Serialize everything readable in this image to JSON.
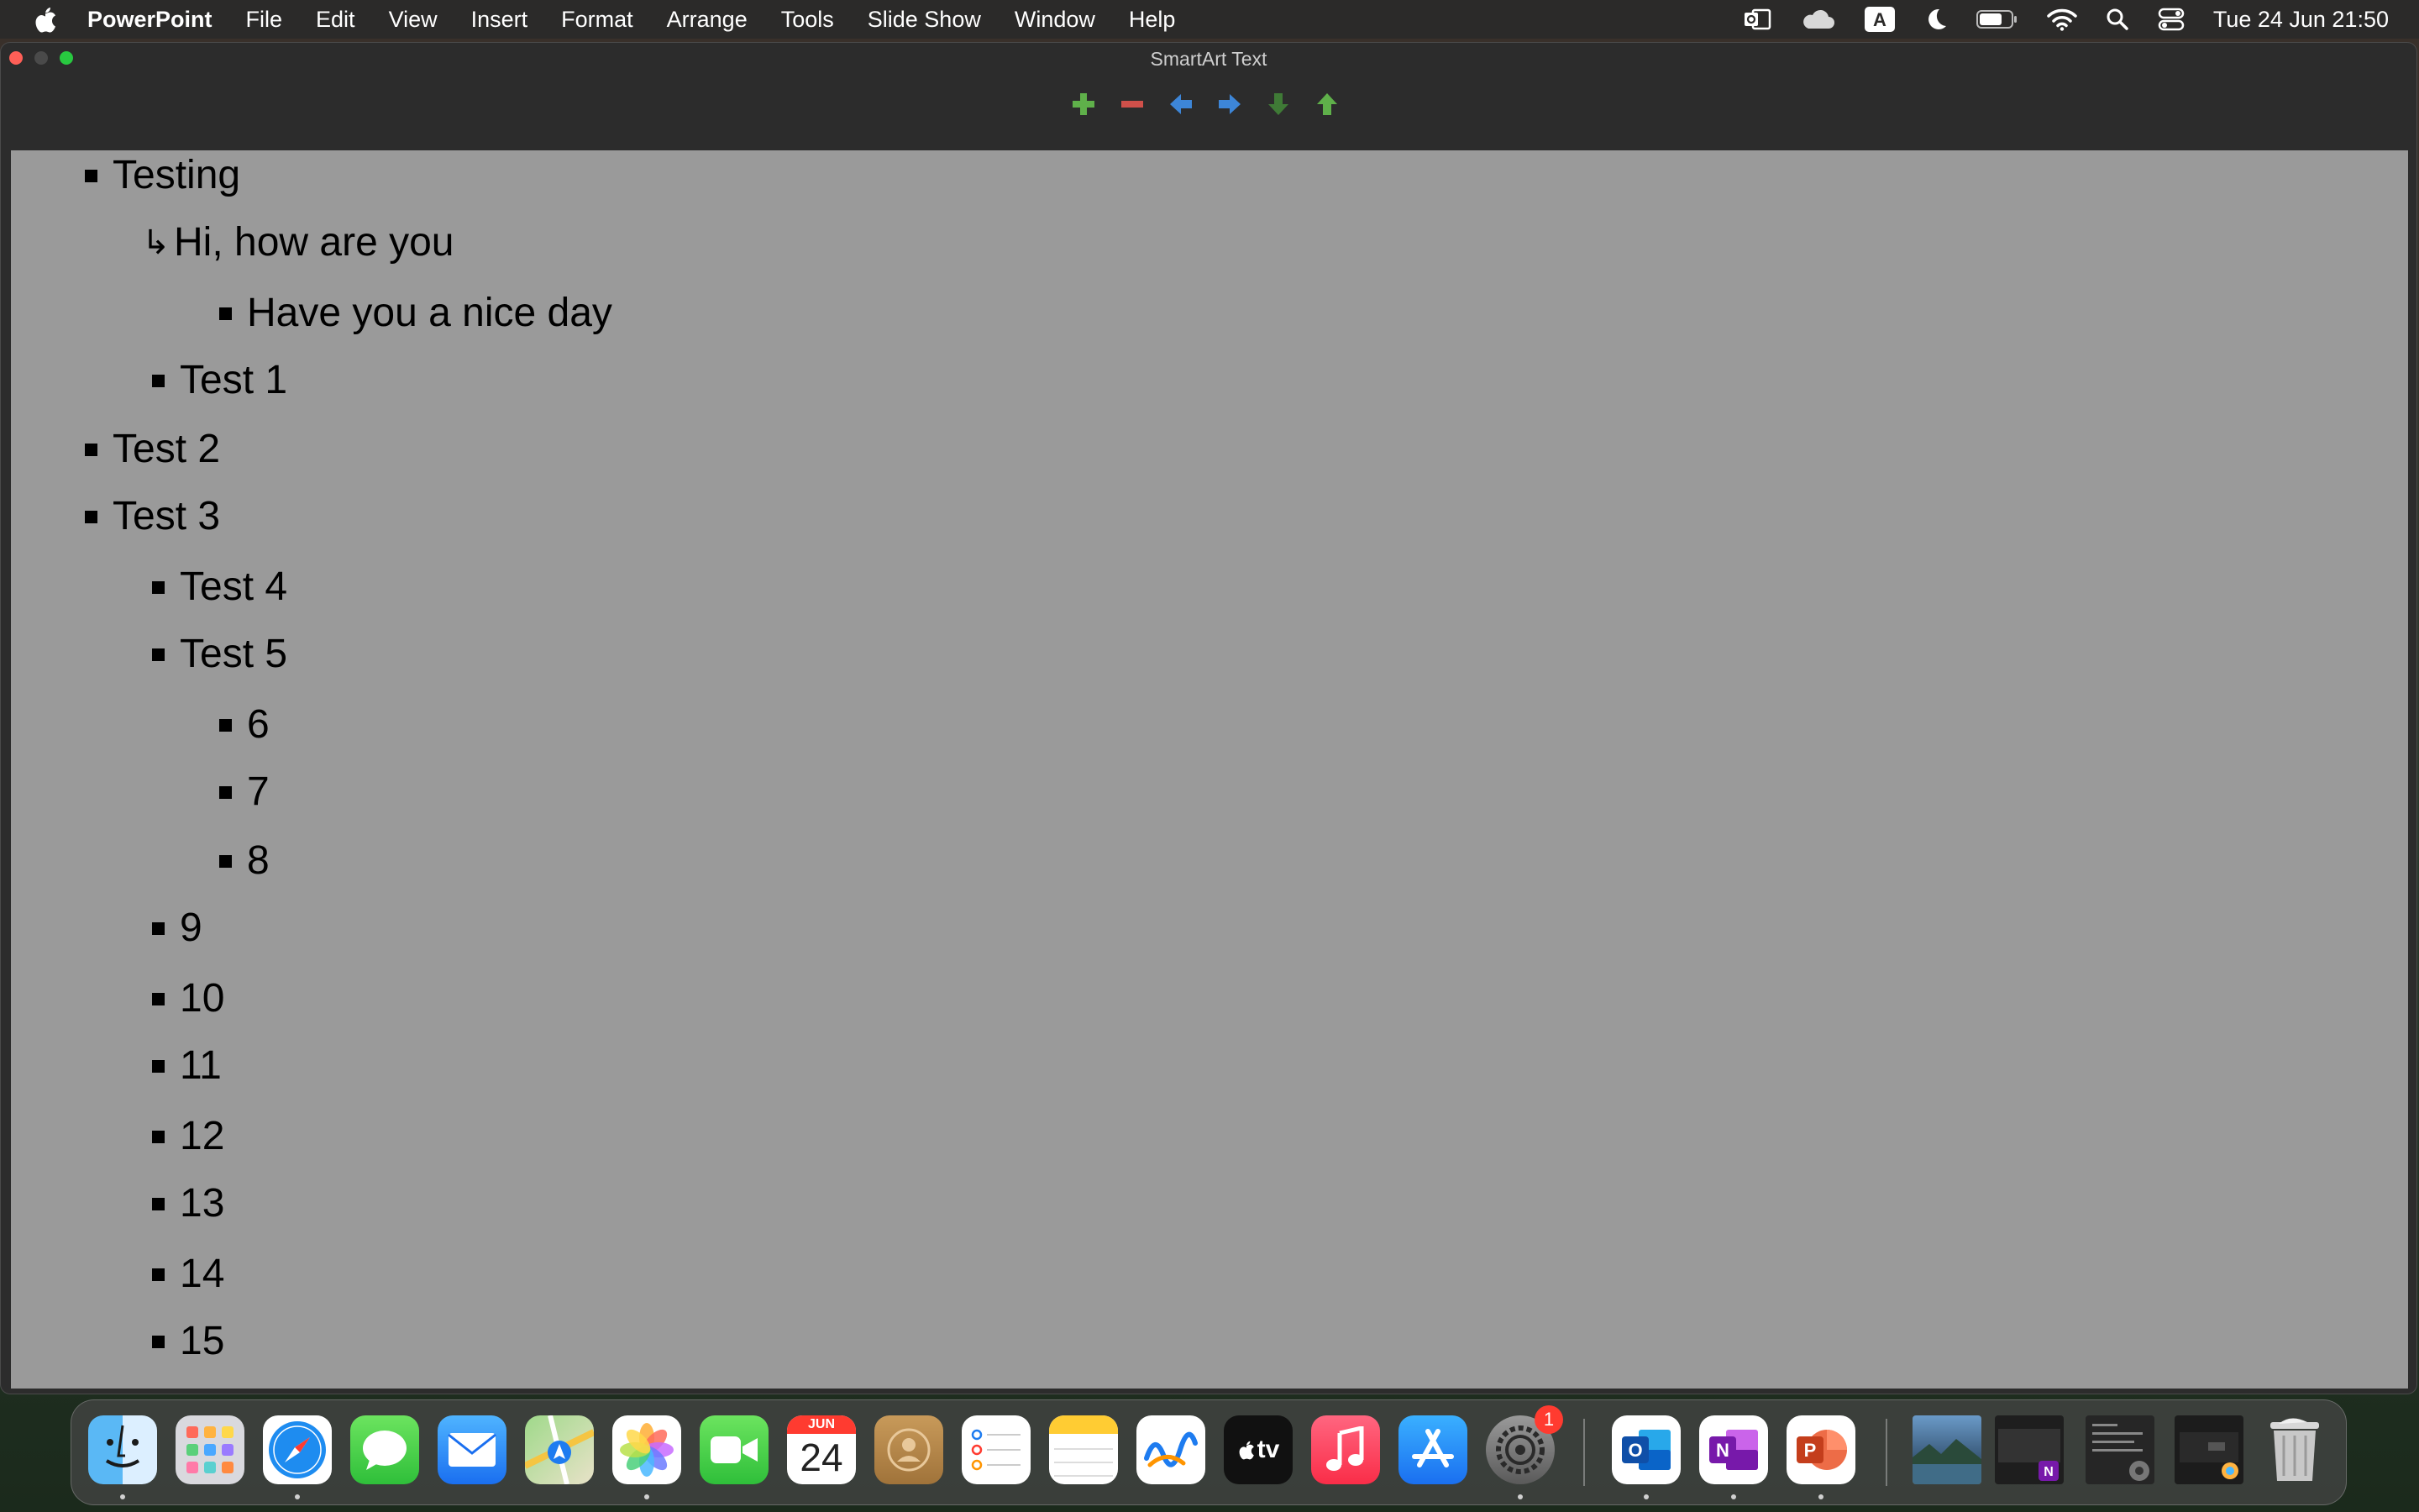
{
  "menubar": {
    "app_name": "PowerPoint",
    "menus": [
      "File",
      "Edit",
      "View",
      "Insert",
      "Format",
      "Arrange",
      "Tools",
      "Slide Show",
      "Window",
      "Help"
    ],
    "status_icons": [
      "outlook-status-icon",
      "onedrive-cloud-icon",
      "input-source-icon",
      "focus-moon-icon",
      "battery-icon",
      "wifi-icon",
      "spotlight-search-icon",
      "control-center-icon"
    ],
    "input_source_label": "A",
    "clock": "Tue 24 Jun  21:50"
  },
  "window": {
    "title": "SmartArt Text",
    "tools": [
      "add-bullet-icon",
      "remove-bullet-icon",
      "promote-left-icon",
      "demote-right-icon",
      "move-down-icon",
      "move-up-icon"
    ],
    "colors": {
      "add": "#5fb04a",
      "remove": "#d0504a",
      "arrow_blue": "#3d86d8",
      "down": "#3f7a36",
      "up": "#5fb04a",
      "content_bg": "#9a9a9a"
    }
  },
  "outline": [
    {
      "text": "Testing",
      "level": 0,
      "marker": "bullet"
    },
    {
      "text": "Hi, how are you",
      "level": 1,
      "marker": "arrow"
    },
    {
      "text": "Have you a nice day",
      "level": 2,
      "marker": "bullet"
    },
    {
      "text": "Test 1",
      "level": 1,
      "marker": "bullet"
    },
    {
      "text": "Test 2",
      "level": 0,
      "marker": "bullet"
    },
    {
      "text": "Test 3",
      "level": 0,
      "marker": "bullet"
    },
    {
      "text": "Test 4",
      "level": 1,
      "marker": "bullet"
    },
    {
      "text": "Test 5",
      "level": 1,
      "marker": "bullet"
    },
    {
      "text": "6",
      "level": 2,
      "marker": "bullet"
    },
    {
      "text": "7",
      "level": 2,
      "marker": "bullet"
    },
    {
      "text": "8",
      "level": 2,
      "marker": "bullet"
    },
    {
      "text": "9",
      "level": 1,
      "marker": "bullet"
    },
    {
      "text": "10",
      "level": 1,
      "marker": "bullet"
    },
    {
      "text": "11",
      "level": 1,
      "marker": "bullet"
    },
    {
      "text": "12",
      "level": 1,
      "marker": "bullet"
    },
    {
      "text": "13",
      "level": 1,
      "marker": "bullet"
    },
    {
      "text": "14",
      "level": 1,
      "marker": "bullet"
    },
    {
      "text": "15",
      "level": 1,
      "marker": "bullet"
    }
  ],
  "dock": {
    "calendar_month": "JUN",
    "calendar_day": "24",
    "settings_badge": "1",
    "tv_label": "tv",
    "apps": [
      {
        "name": "finder-icon",
        "running": true
      },
      {
        "name": "launchpad-icon",
        "running": false
      },
      {
        "name": "safari-icon",
        "running": true
      },
      {
        "name": "messages-icon",
        "running": false
      },
      {
        "name": "mail-icon",
        "running": false
      },
      {
        "name": "maps-icon",
        "running": false
      },
      {
        "name": "photos-icon",
        "running": true
      },
      {
        "name": "facetime-icon",
        "running": false
      },
      {
        "name": "calendar-icon",
        "running": false
      },
      {
        "name": "contacts-icon",
        "running": false
      },
      {
        "name": "reminders-icon",
        "running": false
      },
      {
        "name": "notes-icon",
        "running": false
      },
      {
        "name": "freeform-icon",
        "running": false
      },
      {
        "name": "apple-tv-icon",
        "running": false
      },
      {
        "name": "music-icon",
        "running": false
      },
      {
        "name": "app-store-icon",
        "running": false
      },
      {
        "name": "system-settings-icon",
        "running": true
      },
      {
        "name": "outlook-icon",
        "running": true
      },
      {
        "name": "onenote-icon",
        "running": true
      },
      {
        "name": "powerpoint-icon",
        "running": true
      },
      {
        "name": "minimized-photo-window-icon",
        "running": false
      },
      {
        "name": "minimized-onenote-window-icon",
        "running": false
      },
      {
        "name": "minimized-settings-window-icon",
        "running": false
      },
      {
        "name": "minimized-photos-window-icon",
        "running": false
      },
      {
        "name": "trash-icon",
        "running": false
      }
    ]
  }
}
